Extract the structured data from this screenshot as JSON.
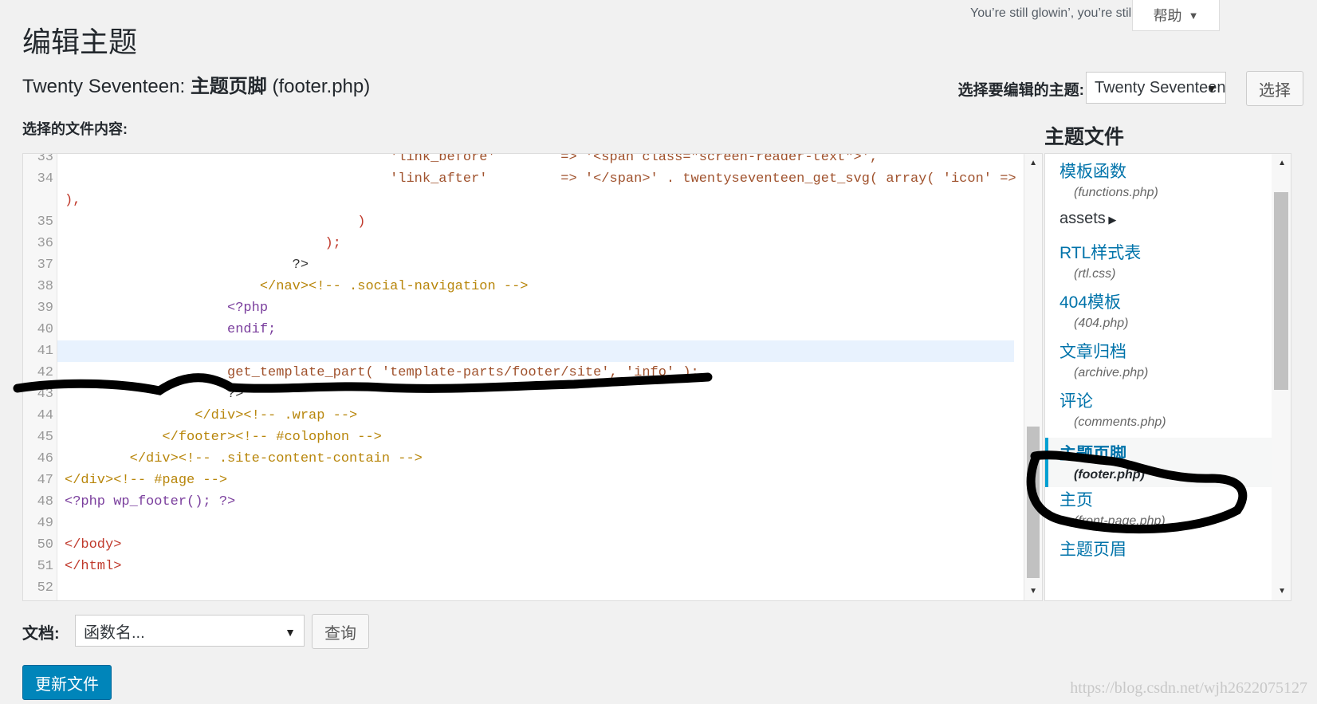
{
  "header": {
    "greeting": "You’re still glowin’, you’re still crowin’",
    "help_label": "帮助",
    "page_title": "编辑主题",
    "file_title_prefix": "Twenty Seventeen:",
    "file_title_name": "主题页脚",
    "file_title_file": "(footer.php)",
    "selected_content_label": "选择的文件内容:"
  },
  "theme_picker": {
    "label": "选择要编辑的主题:",
    "selected": "Twenty Seventeen",
    "button": "选择"
  },
  "files_panel": {
    "title": "主题文件",
    "items": [
      {
        "label": "模板函数",
        "file": "(functions.php)"
      },
      {
        "label": "assets",
        "is_dir": true
      },
      {
        "label": "RTL样式表",
        "file": "(rtl.css)"
      },
      {
        "label": "404模板",
        "file": "(404.php)"
      },
      {
        "label": "文章归档",
        "file": "(archive.php)"
      },
      {
        "label": "评论",
        "file": "(comments.php)"
      },
      {
        "label": "主题页脚",
        "file": "(footer.php)",
        "active": true
      },
      {
        "label": "主页",
        "file": "(front-page.php)"
      },
      {
        "label": "主题页眉",
        "file": ""
      }
    ]
  },
  "editor": {
    "lines": [
      {
        "n": "33",
        "text": "                                        'link_before'        => '<span class=\"screen-reader-text\">',"
      },
      {
        "n": "34",
        "text": "                                        'link_after'         => '</span>' . twentyseventeen_get_svg( array( 'icon' => 'chain' )"
      },
      {
        "n": "",
        "text": "),"
      },
      {
        "n": "35",
        "text": "                                    )"
      },
      {
        "n": "36",
        "text": "                                );"
      },
      {
        "n": "37",
        "text": "                            ?>"
      },
      {
        "n": "38",
        "text": "                        </nav><!-- .social-navigation -->"
      },
      {
        "n": "39",
        "text": "                    <?php"
      },
      {
        "n": "40",
        "text": "                    endif;"
      },
      {
        "n": "41",
        "text": ""
      },
      {
        "n": "42",
        "text": "                    get_template_part( 'template-parts/footer/site', 'info' );"
      },
      {
        "n": "43",
        "text": "                    ?>"
      },
      {
        "n": "44",
        "text": "                </div><!-- .wrap -->"
      },
      {
        "n": "45",
        "text": "            </footer><!-- #colophon -->"
      },
      {
        "n": "46",
        "text": "        </div><!-- .site-content-contain -->"
      },
      {
        "n": "47",
        "text": "</div><!-- #page -->"
      },
      {
        "n": "48",
        "text": "<?php wp_footer(); ?>"
      },
      {
        "n": "49",
        "text": ""
      },
      {
        "n": "50",
        "text": "</body>"
      },
      {
        "n": "51",
        "text": "</html>"
      },
      {
        "n": "52",
        "text": ""
      }
    ],
    "highlighted_line": "42"
  },
  "documentation": {
    "label": "文档:",
    "placeholder": "函数名...",
    "lookup_button": "查询"
  },
  "update_button": "更新文件",
  "watermark": "https://blog.csdn.net/wjh2622075127",
  "colors": {
    "accent": "#0073aa",
    "primary_button": "#0085ba",
    "active_border": "#00a0d2",
    "highlight_row": "#e8f2fe",
    "annotation_ink": "#000000"
  }
}
